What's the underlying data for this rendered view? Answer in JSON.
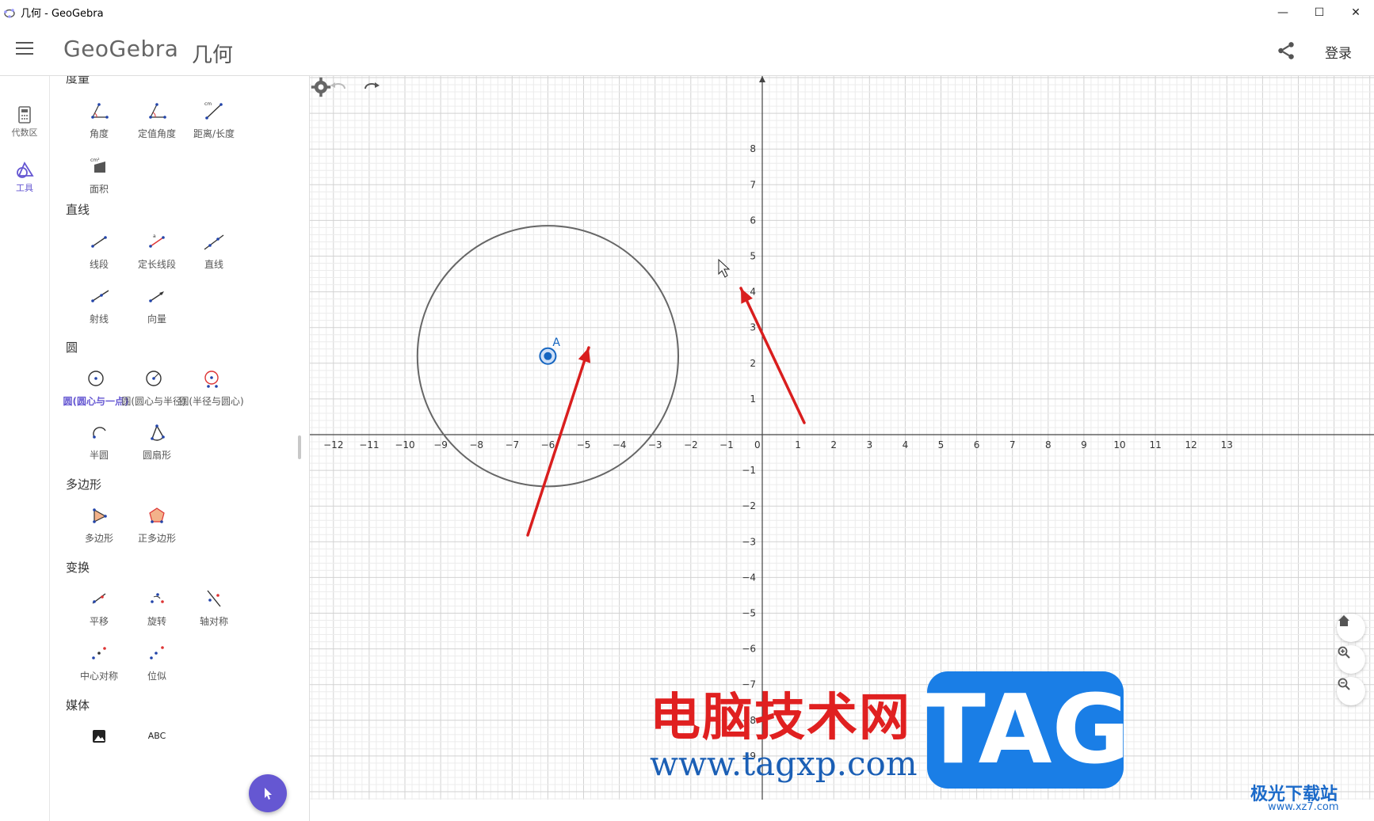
{
  "window": {
    "title": "几何 - GeoGebra",
    "controls": {
      "minimize": "—",
      "maximize": "☐",
      "close": "✕"
    }
  },
  "header": {
    "brand": "GeoGebra",
    "app_title": "几何",
    "share_icon": "share-icon",
    "login_label": "登录"
  },
  "rail": {
    "items": [
      {
        "label": "代数区",
        "icon": "calculator-icon"
      },
      {
        "label": "工具",
        "icon": "tools-icon",
        "active": true
      }
    ]
  },
  "tools": {
    "categories": [
      {
        "title": "度量",
        "items": [
          "角度",
          "定值角度",
          "距离/长度",
          "面积"
        ]
      },
      {
        "title": "直线",
        "items": [
          "线段",
          "定长线段",
          "直线",
          "射线",
          "向量"
        ]
      },
      {
        "title": "圆",
        "items": [
          "圆(圆心与一点)",
          "圆(圆心与半径)",
          "圆(半径与圆心)",
          "半圆",
          "圆扇形"
        ]
      },
      {
        "title": "多边形",
        "items": [
          "多边形",
          "正多边形"
        ]
      },
      {
        "title": "变换",
        "items": [
          "平移",
          "旋转",
          "轴对称",
          "中心对称",
          "位似"
        ]
      },
      {
        "title": "媒体",
        "items": [
          "",
          "ABC"
        ]
      }
    ],
    "selected": "圆(圆心与一点)"
  },
  "graphics": {
    "x_axis_range": [
      -13,
      13
    ],
    "y_axis_range": [
      -9,
      8
    ],
    "grid": true,
    "point": {
      "name": "A",
      "x": -6.0,
      "y": 2.2
    },
    "circle": {
      "center_x": -6.0,
      "center_y": 2.2,
      "radius": 3.65
    },
    "accent": "#6557d2",
    "arrow_color": "#d91e1e"
  },
  "watermark": {
    "cn": "电脑技术网",
    "url": "www.tagxp.com",
    "tag": "TAG",
    "corner": "极光下载站",
    "corner_url": "www.xz7.com"
  }
}
